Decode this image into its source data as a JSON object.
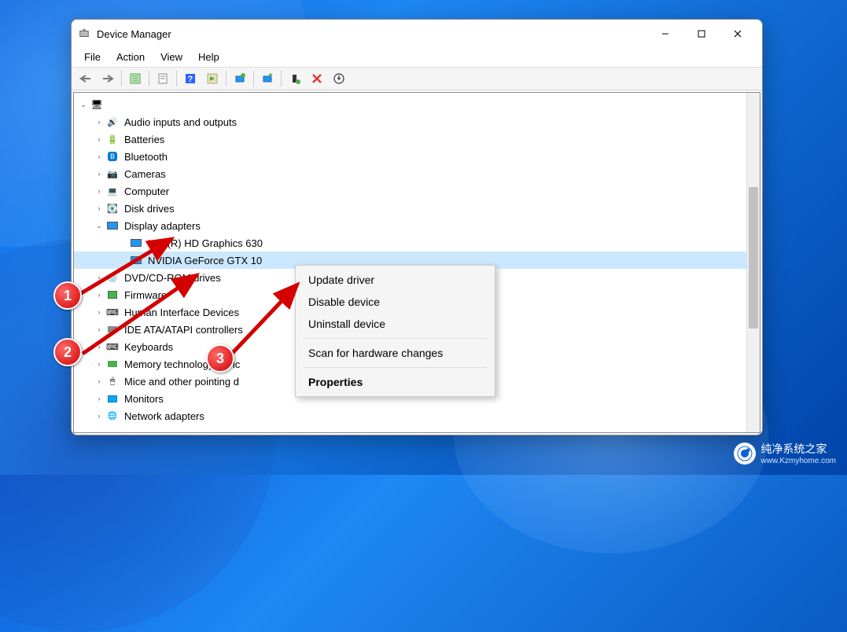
{
  "window": {
    "title": "Device Manager"
  },
  "menubar": {
    "file": "File",
    "action": "Action",
    "view": "View",
    "help": "Help"
  },
  "tree": {
    "root": " ",
    "audio": "Audio inputs and outputs",
    "batteries": "Batteries",
    "bluetooth": "Bluetooth",
    "cameras": "Cameras",
    "computer": "Computer",
    "disk": "Disk drives",
    "display": "Display adapters",
    "display_items": {
      "intel": "Intel(R) HD Graphics 630",
      "nvidia": "NVIDIA GeForce GTX 10"
    },
    "dvd": "DVD/CD-ROM drives",
    "firmware": "Firmware",
    "hid": "Human Interface Devices",
    "ide": "IDE ATA/ATAPI controllers",
    "keyboards": "Keyboards",
    "mem": "Memory technology devic",
    "mice": "Mice and other pointing d",
    "monitors": "Monitors",
    "network": "Network adapters"
  },
  "context_menu": {
    "update": "Update driver",
    "disable": "Disable device",
    "uninstall": "Uninstall device",
    "scan": "Scan for hardware changes",
    "properties": "Properties"
  },
  "annotations": {
    "one": "1",
    "two": "2",
    "three": "3"
  },
  "watermark": {
    "title": "纯净系统之家",
    "url": "www.Kzmyhome.com"
  }
}
